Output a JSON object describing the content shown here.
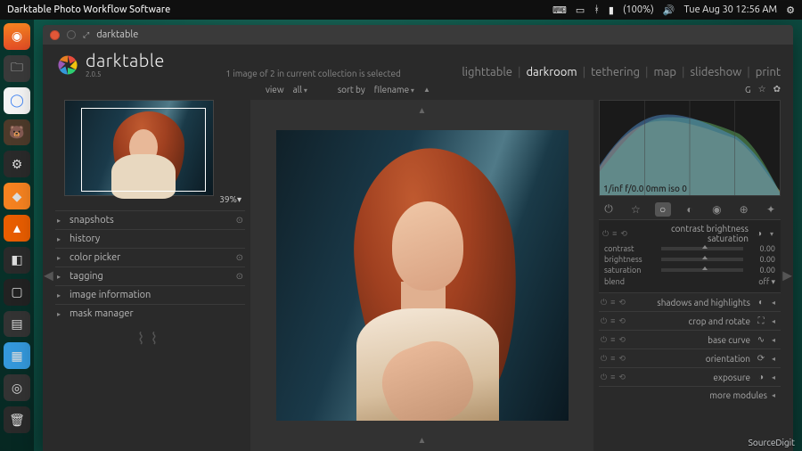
{
  "topbar": {
    "title": "Darktable Photo Workflow Software",
    "battery": "(100%)",
    "datetime": "Tue Aug 30 12:56 AM"
  },
  "titlebar": {
    "title": "darktable"
  },
  "app": {
    "name": "darktable",
    "version": "2.0.5"
  },
  "collection_status": "1 image of 2 in current collection is selected",
  "views": [
    {
      "label": "lighttable",
      "active": false
    },
    {
      "label": "darkroom",
      "active": true
    },
    {
      "label": "tethering",
      "active": false
    },
    {
      "label": "map",
      "active": false
    },
    {
      "label": "slideshow",
      "active": false
    },
    {
      "label": "print",
      "active": false
    }
  ],
  "filterbar": {
    "view_label": "view",
    "view_value": "all",
    "sort_label": "sort by",
    "sort_value": "filename",
    "g_label": "G"
  },
  "thumb_zoom": "39%",
  "left_modules": [
    {
      "label": "snapshots",
      "gear": true
    },
    {
      "label": "history",
      "gear": false
    },
    {
      "label": "color picker",
      "gear": true
    },
    {
      "label": "tagging",
      "gear": true
    },
    {
      "label": "image information",
      "gear": false
    },
    {
      "label": "mask manager",
      "gear": false
    }
  ],
  "histogram_meta": "1/inf f/0.0 0mm iso 0",
  "active_module": {
    "title": "contrast brightness saturation",
    "sliders": [
      {
        "label": "contrast",
        "value": "0.00"
      },
      {
        "label": "brightness",
        "value": "0.00"
      },
      {
        "label": "saturation",
        "value": "0.00"
      }
    ],
    "blend_label": "blend",
    "blend_value": "off"
  },
  "right_modules": [
    {
      "title": "shadows and highlights",
      "icon": "◐"
    },
    {
      "title": "crop and rotate",
      "icon": "⛶"
    },
    {
      "title": "base curve",
      "icon": "∿"
    },
    {
      "title": "orientation",
      "icon": "⟳"
    },
    {
      "title": "exposure",
      "icon": "◑"
    }
  ],
  "more_modules": "more modules",
  "footer": "SourceDigit"
}
